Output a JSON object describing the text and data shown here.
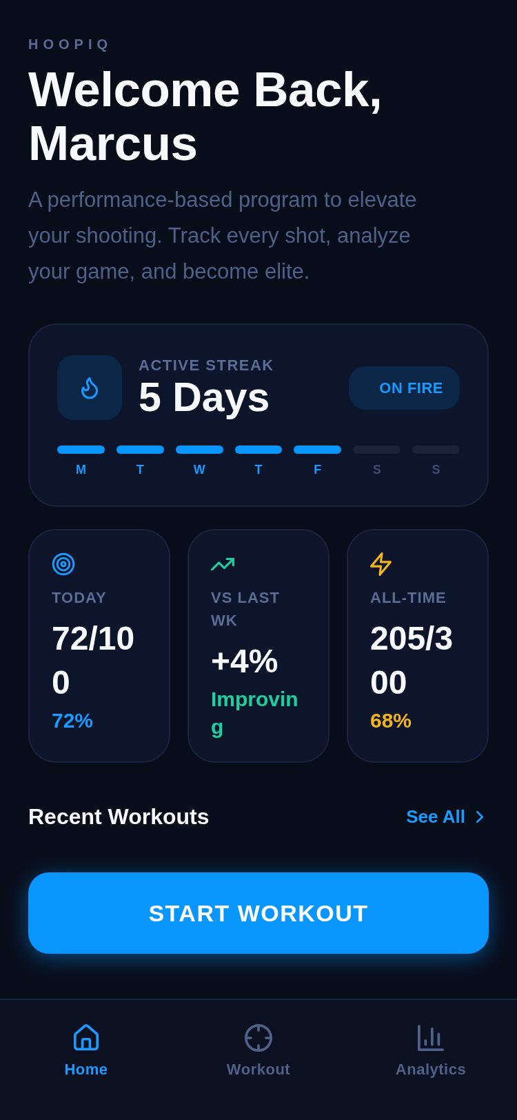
{
  "header": {
    "brand": "HOOPIQ",
    "title": "Welcome Back, Marcus",
    "subtitle": "A performance-based program to elevate your shooting. Track every shot, analyze your game, and become elite."
  },
  "streak": {
    "label": "ACTIVE STREAK",
    "value": "5 Days",
    "badge": "ON FIRE",
    "days": [
      {
        "label": "M",
        "done": true
      },
      {
        "label": "T",
        "done": true
      },
      {
        "label": "W",
        "done": true
      },
      {
        "label": "T",
        "done": true
      },
      {
        "label": "F",
        "done": true
      },
      {
        "label": "S",
        "done": false
      },
      {
        "label": "S",
        "done": false
      }
    ]
  },
  "stats": [
    {
      "kind": "target",
      "label": "TODAY",
      "value": "72/100",
      "detail": "72%",
      "color": "#1a9bff"
    },
    {
      "kind": "trend",
      "label": "VS LAST WK",
      "value": "+4%",
      "detail": "Improving",
      "color": "#1fcf9f"
    },
    {
      "kind": "bolt",
      "label": "ALL-TIME",
      "value": "205/300",
      "detail": "68%",
      "color": "#f5b419"
    }
  ],
  "recent_workouts": {
    "title": "Recent Workouts",
    "link": "See All"
  },
  "start_button": {
    "label": "START WORKOUT"
  },
  "nav": [
    {
      "kind": "home",
      "label": "Home",
      "selected": true
    },
    {
      "kind": "workout",
      "label": "Workout",
      "selected": false
    },
    {
      "kind": "analytics",
      "label": "Analytics",
      "selected": false
    }
  ]
}
